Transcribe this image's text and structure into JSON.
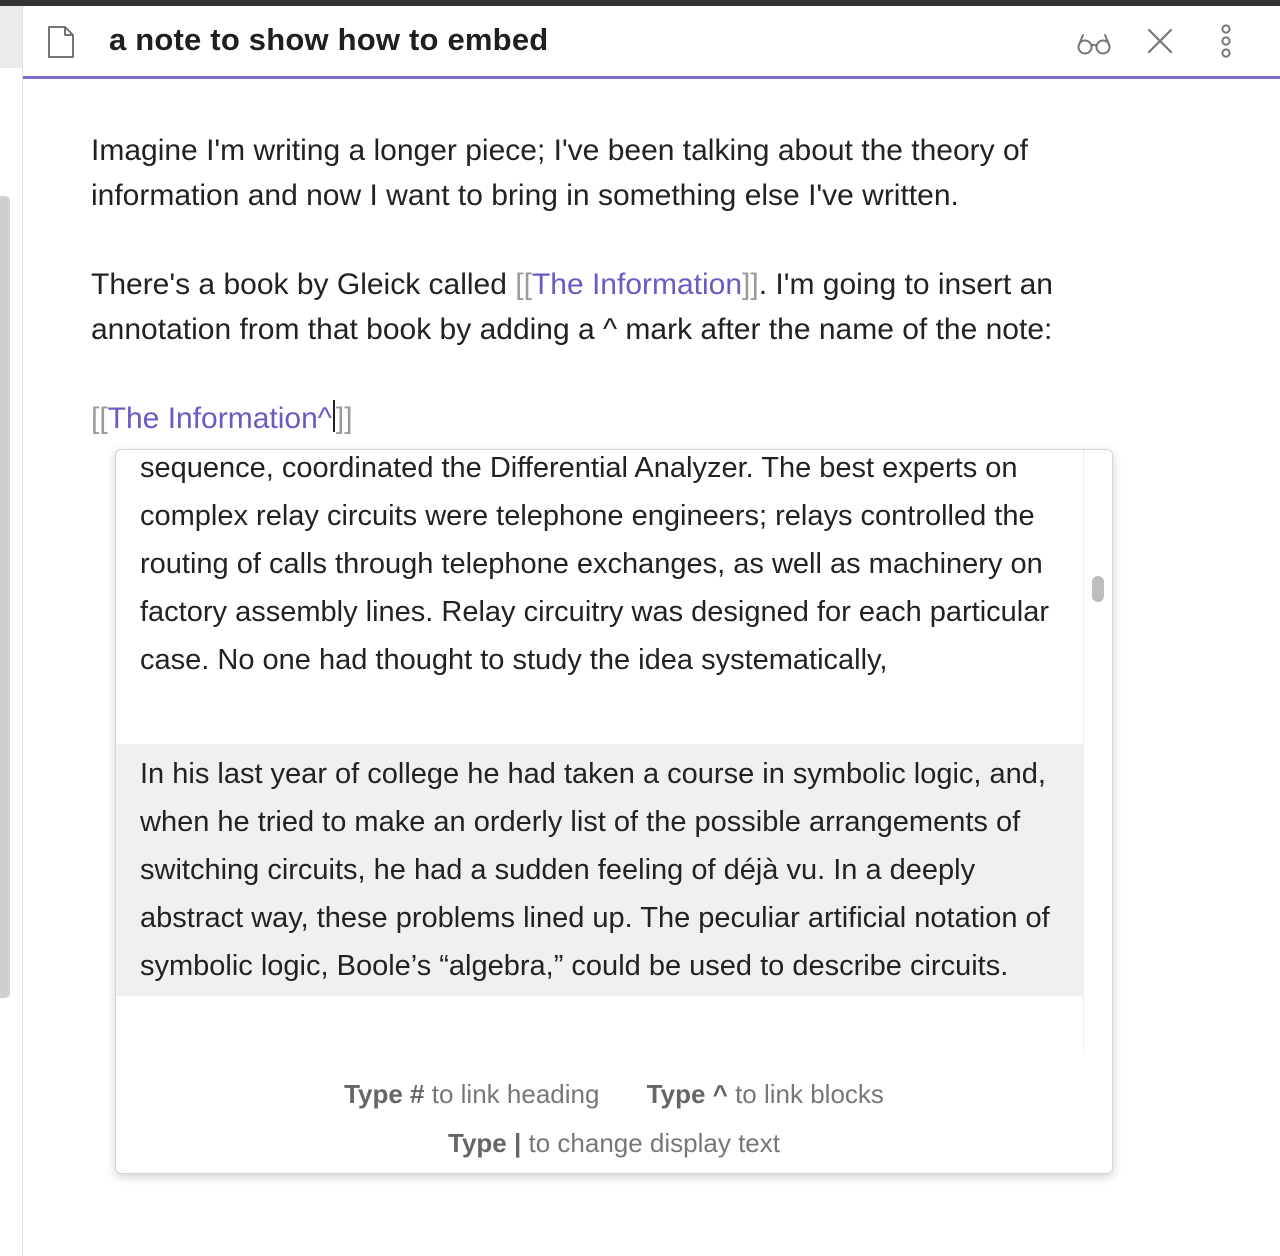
{
  "tab": {
    "title": "a note to show how to embed"
  },
  "icons": {
    "file": "file-icon",
    "reading_view": "glasses-icon",
    "close": "close-icon",
    "more": "more-vertical-icon"
  },
  "editor": {
    "paragraph1": "Imagine I'm writing a longer piece; I've been talking about the theory of information and now I want to bring in something else I've written.",
    "paragraph2_before": "There's a book by Gleick called ",
    "paragraph2_link_open": "[[",
    "paragraph2_link": "The Information",
    "paragraph2_link_close": "]]",
    "paragraph2_after": ". I'm going to insert an annotation from that book by adding a ^ mark after the name of the note:",
    "embed_open": "[[",
    "embed_text": "The Information^",
    "embed_close": "]]"
  },
  "suggestions": [
    {
      "text": "sequence, coordinated the Differential Analyzer. The best experts on complex relay circuits were telephone engineers; relays controlled the routing of calls through telephone exchanges, as well as machinery on factory assembly lines. Relay circuitry was designed for each particular case. No one had thought to study the idea systematically,",
      "selected": false
    },
    {
      "text": "In his last year of college he had taken a course in symbolic logic, and, when he tried to make an orderly list of the possible arrangements of switching circuits, he had a sudden feeling of déjà vu. In a deeply abstract way, these problems lined up. The peculiar artificial notation of symbolic logic, Boole’s “algebra,” could be used to describe circuits.",
      "selected": true
    }
  ],
  "instructions": [
    {
      "command": "Type #",
      "purpose": "to link heading"
    },
    {
      "command": "Type ^",
      "purpose": "to link blocks"
    },
    {
      "command": "Type |",
      "purpose": "to change display text"
    }
  ],
  "colors": {
    "accent": "#7a6fd0",
    "link": "#6a5ac4",
    "bracket": "#9a9a9a",
    "selected_bg": "#f0f0f2"
  }
}
